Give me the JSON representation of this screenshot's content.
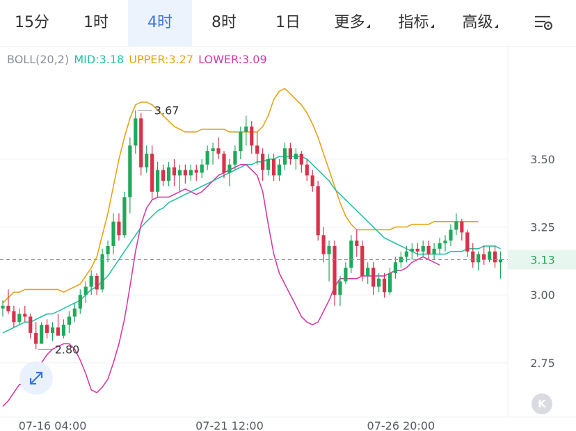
{
  "tabs": [
    {
      "label": "15分",
      "active": false,
      "caret": false
    },
    {
      "label": "1时",
      "active": false,
      "caret": false
    },
    {
      "label": "4时",
      "active": true,
      "caret": false
    },
    {
      "label": "8时",
      "active": false,
      "caret": false
    },
    {
      "label": "1日",
      "active": false,
      "caret": false
    },
    {
      "label": "更多",
      "active": false,
      "caret": true
    },
    {
      "label": "指标",
      "active": false,
      "caret": true
    },
    {
      "label": "高级",
      "active": false,
      "caret": true
    }
  ],
  "settings_icon": "chart-settings-icon",
  "expand_icon": "expand-arrows-icon",
  "kline_button_label": "K",
  "legend": {
    "title": "BOLL(20,2)",
    "mid": "MID:3.18",
    "upper": "UPPER:3.27",
    "lower": "LOWER:3.09"
  },
  "colors": {
    "up": "#1fa95b",
    "down": "#d8324a",
    "mid": "#27c2a4",
    "upper": "#e8a317",
    "lower": "#d63ba7",
    "accent": "#3b74e0"
  },
  "chart_data": {
    "type": "candlestick",
    "indicator": "BOLL(20,2)",
    "y_ticks": [
      "3.50",
      "3.25",
      "3.00",
      "2.75"
    ],
    "x_ticks": [
      "07-16 04:00",
      "07-21 12:00",
      "07-26 20:00"
    ],
    "current_price": "3.13",
    "max_label": "3.67",
    "min_label": "2.80",
    "ylim": [
      2.55,
      3.83
    ],
    "candles": [
      [
        2.95,
        2.98,
        2.92,
        2.96
      ],
      [
        2.96,
        3.02,
        2.93,
        2.94
      ],
      [
        2.94,
        2.96,
        2.88,
        2.9
      ],
      [
        2.9,
        2.95,
        2.89,
        2.93
      ],
      [
        2.93,
        2.96,
        2.9,
        2.92
      ],
      [
        2.92,
        2.93,
        2.84,
        2.86
      ],
      [
        2.86,
        2.9,
        2.8,
        2.82
      ],
      [
        2.82,
        2.9,
        2.82,
        2.89
      ],
      [
        2.89,
        2.91,
        2.84,
        2.86
      ],
      [
        2.86,
        2.9,
        2.83,
        2.88
      ],
      [
        2.88,
        2.93,
        2.86,
        2.85
      ],
      [
        2.85,
        2.91,
        2.84,
        2.89
      ],
      [
        2.89,
        2.94,
        2.86,
        2.92
      ],
      [
        2.92,
        2.97,
        2.9,
        2.95
      ],
      [
        2.95,
        3.02,
        2.93,
        3.0
      ],
      [
        3.0,
        3.05,
        2.97,
        3.03
      ],
      [
        3.03,
        3.09,
        3.0,
        3.07
      ],
      [
        3.07,
        3.08,
        3.0,
        3.02
      ],
      [
        3.02,
        3.17,
        3.01,
        3.15
      ],
      [
        3.15,
        3.2,
        3.12,
        3.18
      ],
      [
        3.18,
        3.3,
        3.15,
        3.27
      ],
      [
        3.27,
        3.3,
        3.2,
        3.22
      ],
      [
        3.22,
        3.38,
        3.21,
        3.36
      ],
      [
        3.36,
        3.58,
        3.3,
        3.55
      ],
      [
        3.55,
        3.68,
        3.52,
        3.65
      ],
      [
        3.65,
        3.67,
        3.44,
        3.47
      ],
      [
        3.47,
        3.55,
        3.45,
        3.52
      ],
      [
        3.52,
        3.55,
        3.35,
        3.38
      ],
      [
        3.38,
        3.49,
        3.36,
        3.46
      ],
      [
        3.46,
        3.48,
        3.4,
        3.42
      ],
      [
        3.42,
        3.49,
        3.4,
        3.47
      ],
      [
        3.47,
        3.5,
        3.4,
        3.44
      ],
      [
        3.44,
        3.48,
        3.38,
        3.46
      ],
      [
        3.46,
        3.48,
        3.41,
        3.44
      ],
      [
        3.44,
        3.48,
        3.42,
        3.46
      ],
      [
        3.46,
        3.48,
        3.42,
        3.45
      ],
      [
        3.45,
        3.5,
        3.43,
        3.48
      ],
      [
        3.48,
        3.55,
        3.46,
        3.53
      ],
      [
        3.53,
        3.56,
        3.48,
        3.54
      ],
      [
        3.54,
        3.58,
        3.5,
        3.52
      ],
      [
        3.52,
        3.53,
        3.43,
        3.45
      ],
      [
        3.45,
        3.5,
        3.4,
        3.48
      ],
      [
        3.48,
        3.55,
        3.46,
        3.53
      ],
      [
        3.53,
        3.62,
        3.5,
        3.6
      ],
      [
        3.6,
        3.66,
        3.55,
        3.62
      ],
      [
        3.62,
        3.64,
        3.52,
        3.55
      ],
      [
        3.55,
        3.6,
        3.48,
        3.52
      ],
      [
        3.52,
        3.54,
        3.42,
        3.46
      ],
      [
        3.46,
        3.52,
        3.44,
        3.5
      ],
      [
        3.5,
        3.52,
        3.42,
        3.44
      ],
      [
        3.44,
        3.5,
        3.42,
        3.48
      ],
      [
        3.48,
        3.56,
        3.46,
        3.54
      ],
      [
        3.54,
        3.56,
        3.48,
        3.5
      ],
      [
        3.5,
        3.54,
        3.46,
        3.52
      ],
      [
        3.52,
        3.53,
        3.45,
        3.48
      ],
      [
        3.48,
        3.5,
        3.42,
        3.44
      ],
      [
        3.44,
        3.46,
        3.38,
        3.4
      ],
      [
        3.4,
        3.42,
        3.2,
        3.22
      ],
      [
        3.22,
        3.25,
        3.12,
        3.15
      ],
      [
        3.15,
        3.2,
        3.05,
        3.18
      ],
      [
        3.18,
        3.2,
        2.96,
        3.0
      ],
      [
        3.0,
        3.07,
        2.96,
        3.05
      ],
      [
        3.05,
        3.12,
        3.04,
        3.1
      ],
      [
        3.1,
        3.22,
        3.08,
        3.2
      ],
      [
        3.2,
        3.24,
        3.14,
        3.18
      ],
      [
        3.18,
        3.2,
        3.05,
        3.07
      ],
      [
        3.07,
        3.12,
        3.04,
        3.1
      ],
      [
        3.1,
        3.12,
        3.0,
        3.03
      ],
      [
        3.03,
        3.08,
        3.01,
        3.06
      ],
      [
        3.06,
        3.08,
        2.99,
        3.01
      ],
      [
        3.01,
        3.1,
        3.0,
        3.08
      ],
      [
        3.08,
        3.14,
        3.06,
        3.12
      ],
      [
        3.12,
        3.16,
        3.1,
        3.14
      ],
      [
        3.14,
        3.18,
        3.12,
        3.16
      ],
      [
        3.16,
        3.19,
        3.13,
        3.17
      ],
      [
        3.17,
        3.19,
        3.14,
        3.16
      ],
      [
        3.16,
        3.2,
        3.14,
        3.18
      ],
      [
        3.18,
        3.2,
        3.13,
        3.15
      ],
      [
        3.15,
        3.19,
        3.13,
        3.17
      ],
      [
        3.17,
        3.21,
        3.15,
        3.19
      ],
      [
        3.19,
        3.22,
        3.16,
        3.2
      ],
      [
        3.2,
        3.26,
        3.18,
        3.24
      ],
      [
        3.24,
        3.3,
        3.22,
        3.27
      ],
      [
        3.27,
        3.28,
        3.2,
        3.23
      ],
      [
        3.23,
        3.24,
        3.14,
        3.16
      ],
      [
        3.16,
        3.19,
        3.1,
        3.12
      ],
      [
        3.12,
        3.16,
        3.09,
        3.15
      ],
      [
        3.15,
        3.18,
        3.11,
        3.13
      ],
      [
        3.13,
        3.18,
        3.12,
        3.16
      ],
      [
        3.16,
        3.18,
        3.1,
        3.12
      ],
      [
        3.12,
        3.16,
        3.06,
        3.13
      ]
    ],
    "mid": [
      2.86,
      2.87,
      2.88,
      2.89,
      2.9,
      2.9,
      2.91,
      2.92,
      2.93,
      2.93,
      2.94,
      2.95,
      2.96,
      2.97,
      2.98,
      3.0,
      3.02,
      3.03,
      3.05,
      3.07,
      3.1,
      3.13,
      3.16,
      3.19,
      3.22,
      3.25,
      3.27,
      3.29,
      3.31,
      3.32,
      3.34,
      3.35,
      3.36,
      3.37,
      3.38,
      3.39,
      3.4,
      3.41,
      3.42,
      3.43,
      3.44,
      3.45,
      3.46,
      3.47,
      3.48,
      3.48,
      3.49,
      3.49,
      3.5,
      3.5,
      3.51,
      3.51,
      3.51,
      3.51,
      3.51,
      3.5,
      3.48,
      3.46,
      3.44,
      3.42,
      3.39,
      3.37,
      3.35,
      3.33,
      3.31,
      3.29,
      3.27,
      3.25,
      3.23,
      3.21,
      3.2,
      3.19,
      3.18,
      3.17,
      3.16,
      3.15,
      3.15,
      3.15,
      3.15,
      3.15,
      3.15,
      3.16,
      3.16,
      3.16,
      3.17,
      3.17,
      3.17,
      3.18,
      3.18,
      3.18,
      3.17
    ],
    "upper": [
      2.97,
      2.99,
      3.01,
      3.01,
      3.02,
      3.02,
      3.02,
      3.02,
      3.02,
      3.02,
      3.02,
      3.01,
      3.02,
      3.03,
      3.04,
      3.07,
      3.1,
      3.14,
      3.22,
      3.3,
      3.4,
      3.5,
      3.58,
      3.65,
      3.7,
      3.71,
      3.71,
      3.7,
      3.68,
      3.66,
      3.64,
      3.62,
      3.61,
      3.6,
      3.6,
      3.6,
      3.61,
      3.61,
      3.61,
      3.61,
      3.61,
      3.6,
      3.6,
      3.6,
      3.6,
      3.6,
      3.6,
      3.62,
      3.66,
      3.72,
      3.75,
      3.76,
      3.74,
      3.72,
      3.7,
      3.67,
      3.63,
      3.58,
      3.52,
      3.46,
      3.4,
      3.34,
      3.29,
      3.26,
      3.24,
      3.24,
      3.24,
      3.24,
      3.24,
      3.24,
      3.24,
      3.25,
      3.25,
      3.25,
      3.26,
      3.26,
      3.26,
      3.26,
      3.27,
      3.27,
      3.27,
      3.27,
      3.27,
      3.27,
      3.27,
      3.27,
      3.27
    ],
    "lower": [
      2.59,
      2.61,
      2.64,
      2.67,
      2.67,
      2.69,
      2.72,
      2.75,
      2.78,
      2.8,
      2.81,
      2.82,
      2.82,
      2.8,
      2.76,
      2.71,
      2.65,
      2.64,
      2.66,
      2.69,
      2.75,
      2.82,
      2.91,
      3.03,
      3.16,
      3.26,
      3.32,
      3.35,
      3.36,
      3.36,
      3.36,
      3.37,
      3.38,
      3.39,
      3.38,
      3.37,
      3.38,
      3.4,
      3.42,
      3.44,
      3.45,
      3.46,
      3.47,
      3.48,
      3.48,
      3.46,
      3.44,
      3.38,
      3.26,
      3.15,
      3.08,
      3.04,
      3.0,
      2.96,
      2.92,
      2.9,
      2.89,
      2.9,
      2.94,
      2.98,
      3.03,
      3.06,
      3.06,
      3.06,
      3.06,
      3.07,
      3.07,
      3.07,
      3.07,
      3.07,
      3.08,
      3.09,
      3.09,
      3.1,
      3.12,
      3.13,
      3.14,
      3.13,
      3.12,
      3.11
    ]
  }
}
